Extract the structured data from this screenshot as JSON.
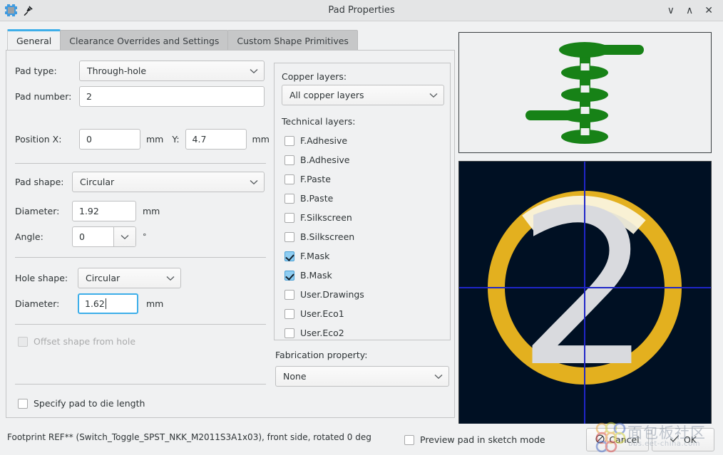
{
  "window": {
    "title": "Pad Properties",
    "app_icon": "kicad-pad-icon",
    "pin_icon": "pin-icon",
    "controls": {
      "minimize": "∨",
      "maximize": "∧",
      "close": "✕"
    }
  },
  "tabs": [
    {
      "label": "General",
      "active": true
    },
    {
      "label": "Clearance Overrides and Settings",
      "active": false
    },
    {
      "label": "Custom Shape Primitives",
      "active": false
    }
  ],
  "general": {
    "pad_type_label": "Pad type:",
    "pad_type_value": "Through-hole",
    "pad_number_label": "Pad number:",
    "pad_number_value": "2",
    "position_x_label": "Position X:",
    "position_x_value": "0",
    "position_x_unit": "mm",
    "position_y_label": "Y:",
    "position_y_value": "4.7",
    "position_y_unit": "mm",
    "pad_shape_label": "Pad shape:",
    "pad_shape_value": "Circular",
    "pad_diameter_label": "Diameter:",
    "pad_diameter_value": "1.92",
    "pad_diameter_unit": "mm",
    "angle_label": "Angle:",
    "angle_value": "0",
    "angle_unit": "°",
    "hole_shape_label": "Hole shape:",
    "hole_shape_value": "Circular",
    "hole_diameter_label": "Diameter:",
    "hole_diameter_value": "1.62",
    "hole_diameter_unit": "mm",
    "offset_label": "Offset shape from hole",
    "offset_checked": false,
    "offset_disabled": true,
    "die_length_label": "Specify pad to die length",
    "die_length_checked": false
  },
  "layers": {
    "copper_label": "Copper layers:",
    "copper_value": "All copper layers",
    "technical_label": "Technical layers:",
    "items": [
      {
        "label": "F.Adhesive",
        "checked": false
      },
      {
        "label": "B.Adhesive",
        "checked": false
      },
      {
        "label": "F.Paste",
        "checked": false
      },
      {
        "label": "B.Paste",
        "checked": false
      },
      {
        "label": "F.Silkscreen",
        "checked": false
      },
      {
        "label": "B.Silkscreen",
        "checked": false
      },
      {
        "label": "F.Mask",
        "checked": true
      },
      {
        "label": "B.Mask",
        "checked": true
      },
      {
        "label": "User.Drawings",
        "checked": false
      },
      {
        "label": "User.Eco1",
        "checked": false
      },
      {
        "label": "User.Eco2",
        "checked": false
      }
    ],
    "fabrication_label": "Fabrication property:",
    "fabrication_value": "None"
  },
  "preview": {
    "stack_color": "#178217",
    "pad_color": "#e3b01f",
    "mask_color": "#fbf6e4",
    "number_color": "#d9dade",
    "number_text": "2",
    "crosshair_color": "#1f26c8",
    "canvas_color": "#001023"
  },
  "footer": {
    "status": "Footprint REF** (Switch_Toggle_SPST_NKK_M2011S3A1x03), front side, rotated 0 deg",
    "sketch_label": "Preview pad in sketch mode",
    "sketch_checked": false,
    "cancel_label": "Cancel",
    "ok_label": "OK",
    "cancel_icon": "cancel-circle-icon",
    "ok_icon": "check-icon"
  },
  "watermark": {
    "text": "面包板社区",
    "sub": "bbs.eet-china.com"
  }
}
